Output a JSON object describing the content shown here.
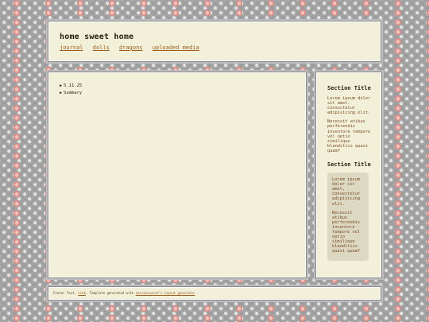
{
  "header": {
    "title": "home sweet home",
    "nav": [
      "journal",
      "dolls",
      "dragons",
      "uploaded media"
    ]
  },
  "main": {
    "toggles": [
      "5.11.25",
      "Summary"
    ]
  },
  "sidebar": {
    "section1_title": "Section Title",
    "section1_p1": "Lorem ipsum dolor sit amet, consectetur adipisicing elit.",
    "section1_p2": "Necessit atibus perferendis inventore tempore vel optio similique blanditiis quasi quam?",
    "section2_title": "Section Title",
    "callout_p1": "Lorem ipsum dolor sit amet, consectetur adipisicing elit.",
    "callout_p2": "Necessit atibus perferendis inventore tempore vel optio similique blanditiis quasi quam?"
  },
  "footer": {
    "text_before": "Footer Text.",
    "link1": "Link",
    "text_mid": ". Template generated with",
    "link2": "necrowizzard's layout generator",
    "text_after": "."
  },
  "icons": {
    "toggle": "triangle-right-icon"
  }
}
